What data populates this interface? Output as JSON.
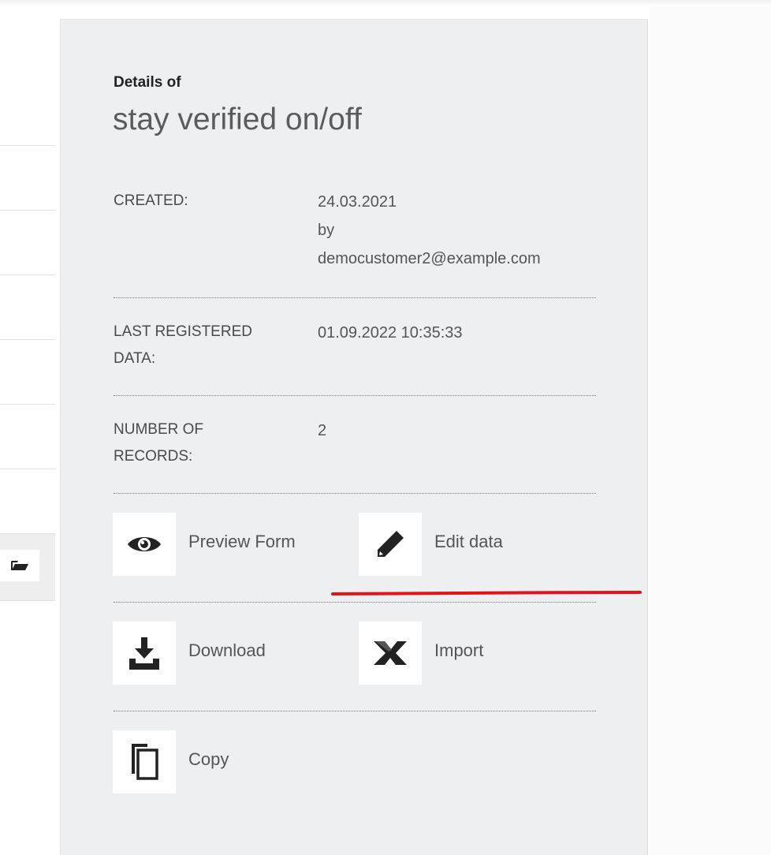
{
  "details": {
    "label": "Details of",
    "title": "stay verified on/off"
  },
  "info": {
    "created_label": "CREATED:",
    "created_date": "24.03.2021",
    "created_by": "by",
    "created_email": "democustomer2@example.com",
    "last_registered_label_1": "LAST REGISTERED",
    "last_registered_label_2": "DATA:",
    "last_registered_value": "01.09.2022 10:35:33",
    "records_label_1": "NUMBER OF",
    "records_label_2": "RECORDS:",
    "records_value": "2"
  },
  "actions": {
    "preview_form": "Preview Form",
    "edit_data": "Edit data",
    "download": "Download",
    "import": "Import",
    "copy": "Copy"
  },
  "colors": {
    "panel_bg": "#eeeff1",
    "annotation_red": "#e0151b"
  },
  "icons": {
    "preview": "eye-icon",
    "edit": "pencil-icon",
    "download": "download-tray-icon",
    "import": "excel-x-icon",
    "copy": "copy-icon",
    "folder": "folder-open-icon"
  }
}
